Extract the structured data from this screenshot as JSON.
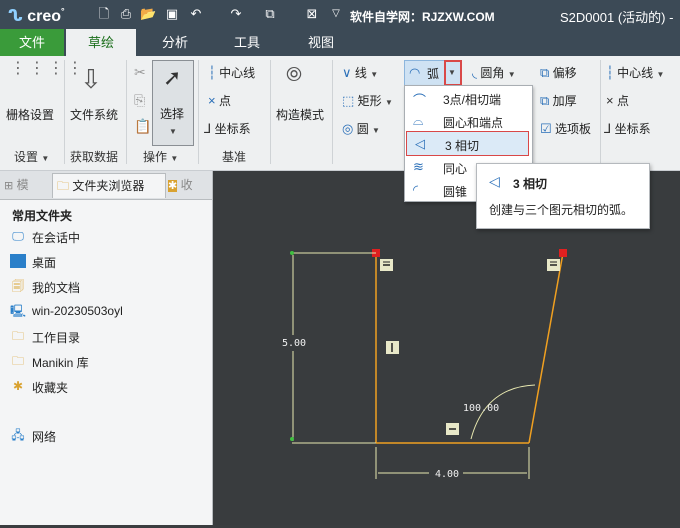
{
  "titlebar": {
    "logo": "creo",
    "logo_suffix": "°",
    "site_text": "软件自学网：RJZXW.COM",
    "window_title": "S2D0001 (活动的) -",
    "quick_access": [
      "new-icon",
      "print-icon",
      "open-icon",
      "save-icon",
      "undo-icon",
      "redo-icon",
      "regenerate-icon",
      "close-window-icon",
      "customize-icon"
    ]
  },
  "tabs": [
    {
      "label": "文件"
    },
    {
      "label": "草绘"
    },
    {
      "label": "分析"
    },
    {
      "label": "工具"
    },
    {
      "label": "视图"
    }
  ],
  "ribbon": {
    "grid_settings": "栅格设置",
    "file_system": "文件系统",
    "select": "选择",
    "centerline": "中心线",
    "point": "点",
    "coordinate_system": "坐标系",
    "construction_mode": "构造模式",
    "line": "线",
    "arc": "弧",
    "fillet": "圆角",
    "offset": "偏移",
    "centerline2": "中心线",
    "rectangle": "矩形",
    "thicken": "加厚",
    "point2": "点",
    "circle": "圆",
    "palette": "选项板",
    "coordinate_system2": "坐标系",
    "groups": {
      "settings": "设置",
      "get_data": "获取数据",
      "operations": "操作",
      "datum": "基准"
    }
  },
  "arc_menu": [
    {
      "label": "3点/相切端",
      "icon": "arc-3point-icon"
    },
    {
      "label": "圆心和端点",
      "icon": "arc-center-end-icon"
    },
    {
      "label": "3 相切",
      "icon": "arc-3tangent-icon"
    },
    {
      "label": "同心",
      "icon": "arc-concentric-icon"
    },
    {
      "label": "圆锥",
      "icon": "arc-conic-icon"
    }
  ],
  "tooltip": {
    "title": "3 相切",
    "description": "创建与三个图元相切的弧。"
  },
  "panel": {
    "tabs": [
      "模",
      "文件夹浏览器",
      "收"
    ],
    "section_title": "常用文件夹",
    "items": [
      {
        "label": "在会话中",
        "icon": "in-session-icon"
      },
      {
        "label": "桌面",
        "icon": "desktop-icon"
      },
      {
        "label": "我的文档",
        "icon": "my-documents-icon"
      },
      {
        "label": "win-20230503oyl",
        "icon": "computer-icon"
      },
      {
        "label": "工作目录",
        "icon": "working-directory-icon"
      },
      {
        "label": "Manikin 库",
        "icon": "manikin-library-icon"
      },
      {
        "label": "收藏夹",
        "icon": "favorites-icon"
      },
      {
        "label": "网络",
        "icon": "network-icon"
      }
    ]
  },
  "sketch": {
    "dim_height": "5.00",
    "dim_width": "4.00",
    "dim_angle": "100.00"
  }
}
